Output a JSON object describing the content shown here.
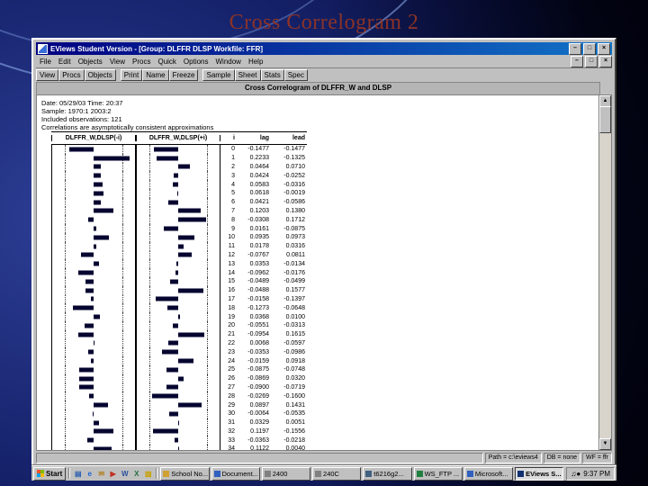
{
  "slide": {
    "title": "Cross Correlogram 2"
  },
  "app_window": {
    "title": "EViews Student Version - [Group: DLFFR DLSP  Workfile: FFR]",
    "window_controls": [
      {
        "name": "minimize-button",
        "glyph": "–"
      },
      {
        "name": "maximize-button",
        "glyph": "□"
      },
      {
        "name": "close-button",
        "glyph": "×"
      }
    ],
    "menu": [
      "File",
      "Edit",
      "Objects",
      "View",
      "Procs",
      "Quick",
      "Options",
      "Window",
      "Help"
    ],
    "toolbar_groups": [
      [
        "View",
        "Procs",
        "Objects"
      ],
      [
        "Print",
        "Name",
        "Freeze"
      ],
      [
        "Sample",
        "Sheet",
        "Stats",
        "Spec"
      ]
    ],
    "doc_header": "Cross Correlogram of DLFFR_W and DLSP",
    "info_lines": [
      "Date: 05/29/03   Time: 20:37",
      "Sample: 1970:1 2003:2",
      "Included observations: 121",
      "Correlations are asymptotically consistent approximations"
    ],
    "status": {
      "path": "Path = c:\\eviews4",
      "db": "DB = none",
      "wf": "WF = ffr"
    }
  },
  "chart_data": {
    "type": "bar",
    "title": "Cross Correlogram of DLFFR_W and DLSP",
    "col_headers": [
      "DLFFR_W,DLSP(-i)",
      "DLFFR_W,DLSP(+i)",
      "i",
      "lag",
      "lead"
    ],
    "i": [
      0,
      1,
      2,
      3,
      4,
      5,
      6,
      7,
      8,
      9,
      10,
      11,
      12,
      13,
      14,
      15,
      16,
      17,
      18,
      19,
      20,
      21,
      22,
      23,
      24,
      25,
      26,
      27,
      28,
      29,
      30,
      31,
      32,
      33,
      34
    ],
    "series": [
      {
        "name": "lag",
        "values": [
          -0.1477,
          0.2233,
          0.0464,
          0.0424,
          0.0583,
          0.0618,
          0.0421,
          0.1203,
          -0.0308,
          0.0161,
          0.0935,
          0.0178,
          -0.0767,
          0.0353,
          -0.0962,
          -0.0489,
          -0.0488,
          -0.0158,
          -0.1273,
          0.0368,
          -0.0551,
          -0.0954,
          0.0068,
          -0.0353,
          -0.0159,
          -0.0875,
          -0.0869,
          -0.09,
          -0.0269,
          0.0897,
          -0.0064,
          0.0329,
          0.1197,
          -0.0363,
          0.1122
        ]
      },
      {
        "name": "lead",
        "values": [
          -0.1477,
          -0.1325,
          0.071,
          -0.0252,
          -0.0316,
          -0.0019,
          -0.0586,
          0.138,
          0.1712,
          -0.0875,
          0.0973,
          0.0316,
          0.0811,
          -0.0134,
          -0.0176,
          -0.0499,
          0.1577,
          -0.1397,
          -0.0648,
          0.01,
          -0.0313,
          0.1615,
          -0.0597,
          -0.0986,
          0.0918,
          -0.0748,
          0.032,
          -0.0719,
          -0.16,
          0.1431,
          -0.0535,
          0.0051,
          -0.1556,
          -0.0218,
          0.004
        ]
      }
    ],
    "confidence_band": 0.18,
    "xlim": [
      -0.25,
      0.25
    ],
    "grid": false,
    "legend": "none"
  },
  "taskbar": {
    "start_label": "Start",
    "quick_launch": [
      {
        "name": "show-desktop-icon",
        "glyph": "▤",
        "color": "#2a5fb0"
      },
      {
        "name": "ie-icon",
        "glyph": "e",
        "color": "#1a62d6"
      },
      {
        "name": "outlook-icon",
        "glyph": "✉",
        "color": "#b08020"
      },
      {
        "name": "media-player-icon",
        "glyph": "▶",
        "color": "#c03020"
      },
      {
        "name": "word-icon",
        "glyph": "W",
        "color": "#2a50a0"
      },
      {
        "name": "excel-icon",
        "glyph": "X",
        "color": "#207040"
      },
      {
        "name": "folder-icon",
        "glyph": "▨",
        "color": "#c8a000"
      }
    ],
    "buttons": [
      {
        "label": "School No...",
        "color": "#d0a030",
        "active": false
      },
      {
        "label": "Document...",
        "color": "#3060c0",
        "active": false
      },
      {
        "label": "2400",
        "color": "#808080",
        "active": false
      },
      {
        "label": "240C",
        "color": "#808080",
        "active": false
      },
      {
        "label": "t6216g2...",
        "color": "#406080",
        "active": false
      },
      {
        "label": "WS_FTP ...",
        "color": "#208040",
        "active": false
      },
      {
        "label": "Microsoft...",
        "color": "#3060c0",
        "active": false
      },
      {
        "label": "EViews S...",
        "color": "#103070",
        "active": true
      }
    ],
    "tray_icons": [
      {
        "name": "volume-icon",
        "glyph": "♫"
      },
      {
        "name": "network-icon",
        "glyph": "●"
      }
    ],
    "tray_time": "9:37 PM"
  }
}
